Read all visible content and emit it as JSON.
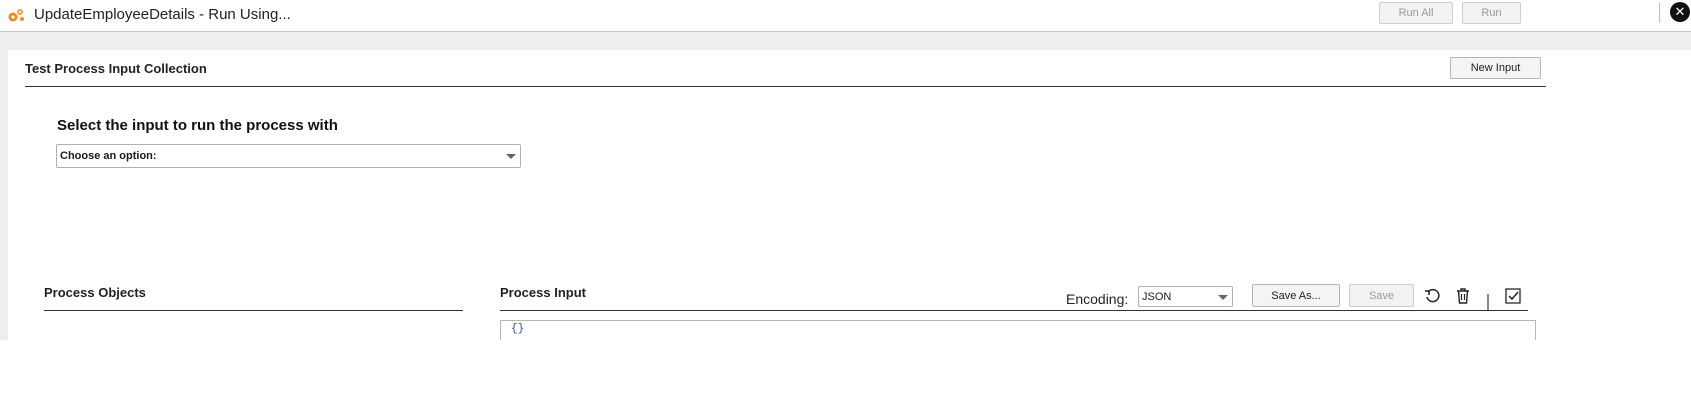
{
  "titlebar": {
    "title": "UpdateEmployeeDetails - Run Using...",
    "run_all_label": "Run All",
    "run_label": "Run",
    "close_icon": "close-circle-icon",
    "app_icon": "process-gears-icon"
  },
  "collection": {
    "title": "Test Process Input Collection",
    "new_input_label": "New Input"
  },
  "selector": {
    "prompt": "Select the input to run the process with",
    "selected": "Choose an option:"
  },
  "objects": {
    "title": "Process Objects"
  },
  "input": {
    "title": "Process Input",
    "encoding_label": "Encoding:",
    "encoding_value": "JSON",
    "save_as_label": "Save As...",
    "save_label": "Save",
    "editor_text": "{}",
    "icons": [
      "undo-icon",
      "delete-icon",
      "validate-icon"
    ]
  },
  "colors": {
    "accent_orange": "#f08a1e",
    "background_gray": "#eeeeee",
    "editor_text": "#2a4a8a"
  }
}
